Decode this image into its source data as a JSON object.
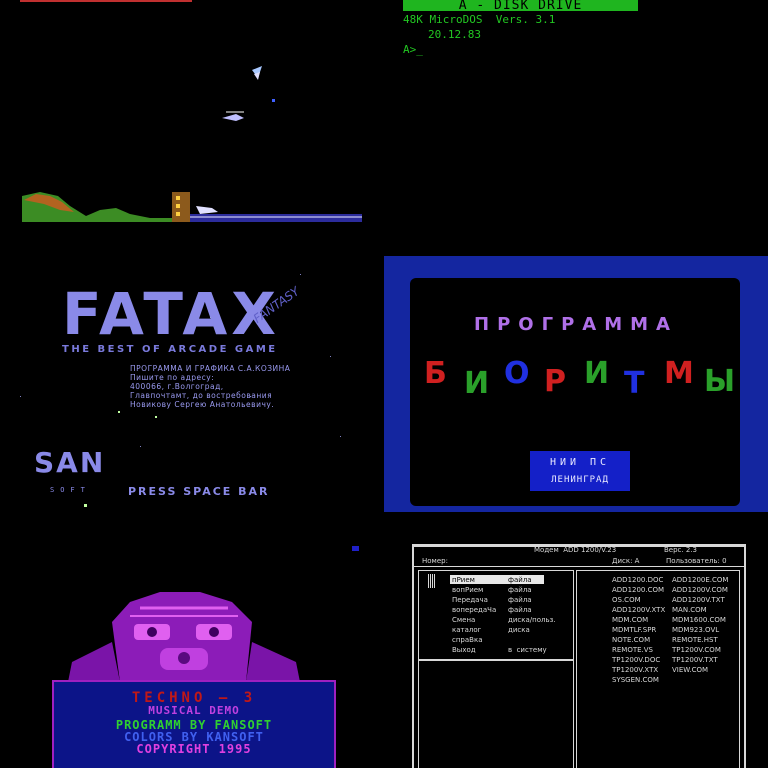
{
  "dos": {
    "header": "A - DISK DRIVE",
    "line1": "48K MicroDOS  Vers. 3.1",
    "line2": "20.12.83",
    "prompt": "A>_"
  },
  "fatax": {
    "title": "FATAX",
    "fantasy": "FANTASY",
    "subtitle": "THE BEST OF ARCADE GAME",
    "info": [
      "ПРОГРАММА И ГРАФИКА С.А.КОЗИНА",
      "Пишите по адресу:",
      "400066, г.Волгоград,",
      "Главпочтамт, до востребования",
      "Новикову Сергею Анатольевичу."
    ],
    "logo": "SAN",
    "logo_sub": "SOFT",
    "press": "PRESS SPACE BAR"
  },
  "bio": {
    "title": "ПРОГРАММА",
    "letters": [
      {
        "ch": "Б",
        "color": "#d02020"
      },
      {
        "ch": "И",
        "color": "#2aa02a"
      },
      {
        "ch": "О",
        "color": "#2030e0"
      },
      {
        "ch": "Р",
        "color": "#d02020"
      },
      {
        "ch": "И",
        "color": "#2aa02a"
      },
      {
        "ch": "Т",
        "color": "#2030e0"
      },
      {
        "ch": "М",
        "color": "#d02020"
      },
      {
        "ch": "Ы",
        "color": "#2aa02a"
      }
    ],
    "box_line1": "НИИ ПС",
    "box_line2": "ЛЕНИНГРАД"
  },
  "techno": {
    "title": "TECHNO — 3",
    "demo": "MUSICAL DEMO",
    "line1": "PROGRAMM BY FANSOFT",
    "line2": "COLORS  BY KANSOFT",
    "line3": "COPYRIGHT 1995"
  },
  "modem": {
    "top_left": "Модем  ADD 1200/V.23",
    "top_right": "Верс. 2.3",
    "number_label": "Номер:",
    "disk_label": "Диск: A",
    "user_label": "Пользователь: 0",
    "menu": [
      {
        "a": "пРием",
        "b": "файла"
      },
      {
        "a": "вопРием",
        "b": "файла"
      },
      {
        "a": "Передача",
        "b": "файла"
      },
      {
        "a": "вопередаЧа",
        "b": "файла"
      },
      {
        "a": "Смена",
        "b": "диска/польз."
      },
      {
        "a": "каталог",
        "b": "диска"
      },
      {
        "a": "спраВка",
        "b": ""
      },
      {
        "a": "Выход",
        "b": "в  систему"
      }
    ],
    "files_col1": [
      "ADD1200.DOC",
      "ADD1200.COM",
      "OS.COM",
      "ADD1200V.XTX",
      "MDM.COM",
      "MDMTLF.SPR",
      "NOTE.COM",
      "REMOTE.VS",
      "TP1200V.DOC",
      "TP1200V.XTX",
      "SYSGEN.COM"
    ],
    "files_col2": [
      "ADD1200E.COM",
      "ADD1200V.COM",
      "ADD1200V.TXT",
      "MAN.COM",
      "MDM1600.COM",
      "MDM923.OVL",
      "REMOTE.HST",
      "TP1200V.COM",
      "TP1200V.TXT",
      "VIEW.COM"
    ]
  }
}
